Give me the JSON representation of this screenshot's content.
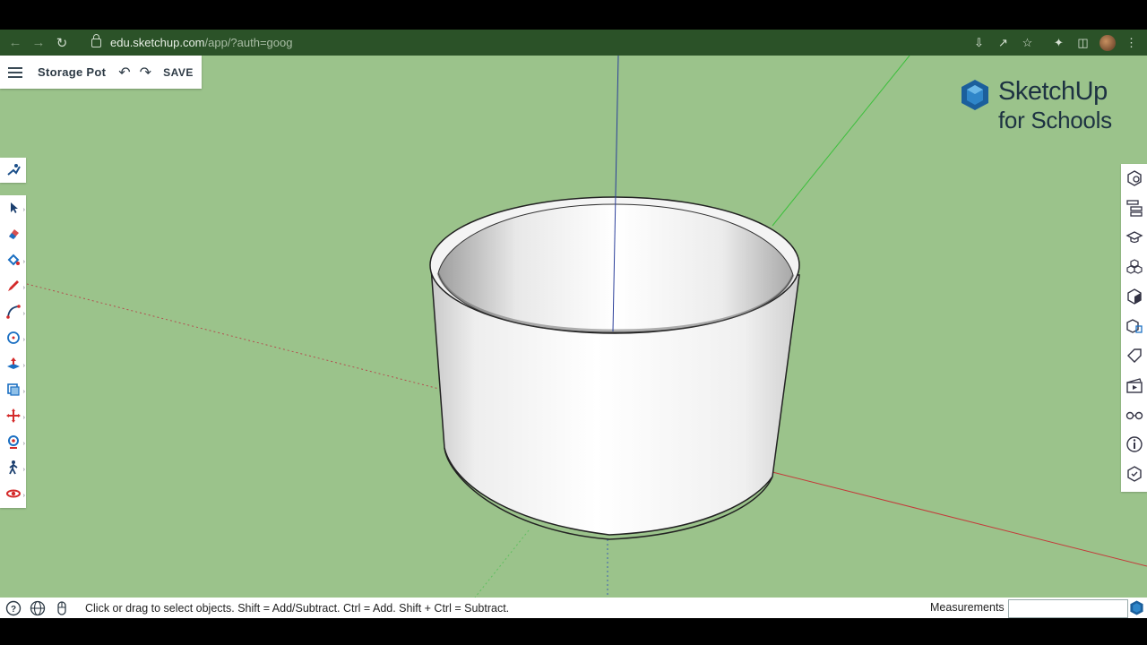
{
  "browser": {
    "url_host": "edu.sketchup.com",
    "url_path": "/app/?auth=goog"
  },
  "document": {
    "title": "Storage Pot",
    "save_label": "SAVE"
  },
  "logo": {
    "line1": "SketchUp",
    "line2": "for Schools",
    "color": "#1d3242",
    "mark_color": "#1b5f9c"
  },
  "left_toolbar": {
    "items": [
      "select-icon",
      "eraser-icon",
      "paint-bucket-icon",
      "pencil-icon",
      "arc-icon",
      "circle-icon",
      "push-pull-icon",
      "offset-icon",
      "move-icon",
      "rotate-icon",
      "walk-icon",
      "orbit-icon"
    ]
  },
  "right_toolbar": {
    "items": [
      "entity-info-icon",
      "outliner-icon",
      "instructor-icon",
      "components-icon",
      "materials-icon",
      "styles-icon",
      "tags-icon",
      "scenes-icon",
      "display-icon",
      "info-icon",
      "solid-inspector-icon"
    ]
  },
  "status_bar": {
    "message": "Click or drag to select objects. Shift = Add/Subtract. Ctrl = Add. Shift + Ctrl = Subtract.",
    "measurements_label": "Measurements",
    "measurements_value": ""
  },
  "colors": {
    "sky": "#9bc38b",
    "chrome": "#2b5228",
    "accent_red": "#d42a2a",
    "accent_blue": "#1b6fc2"
  }
}
